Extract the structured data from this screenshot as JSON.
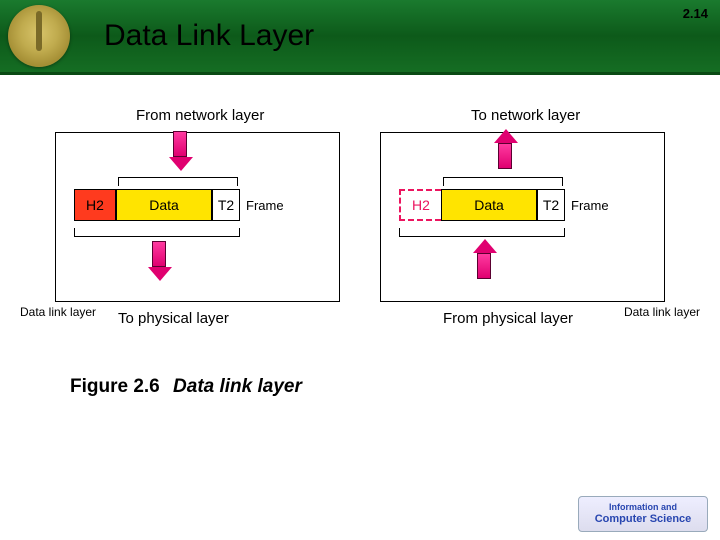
{
  "header": {
    "title": "Data Link Layer",
    "page_number": "2.14"
  },
  "diagram": {
    "left": {
      "top_label": "From network layer",
      "bottom_label": "To physical layer",
      "corner_label": "Data link layer",
      "h2": "H2",
      "data": "Data",
      "t2": "T2",
      "frame": "Frame"
    },
    "right": {
      "top_label": "To network layer",
      "bottom_label": "From physical layer",
      "corner_label": "Data link layer",
      "h2": "H2",
      "data": "Data",
      "t2": "T2",
      "frame": "Frame"
    }
  },
  "caption": {
    "figure": "Figure 2.6",
    "text": "Data link layer"
  },
  "footer": {
    "line1": "Information and",
    "line2": "Computer Science"
  },
  "colors": {
    "header_green": "#156d23",
    "red": "#ff3a1e",
    "yellow": "#ffe400",
    "magenta": "#e00070"
  }
}
